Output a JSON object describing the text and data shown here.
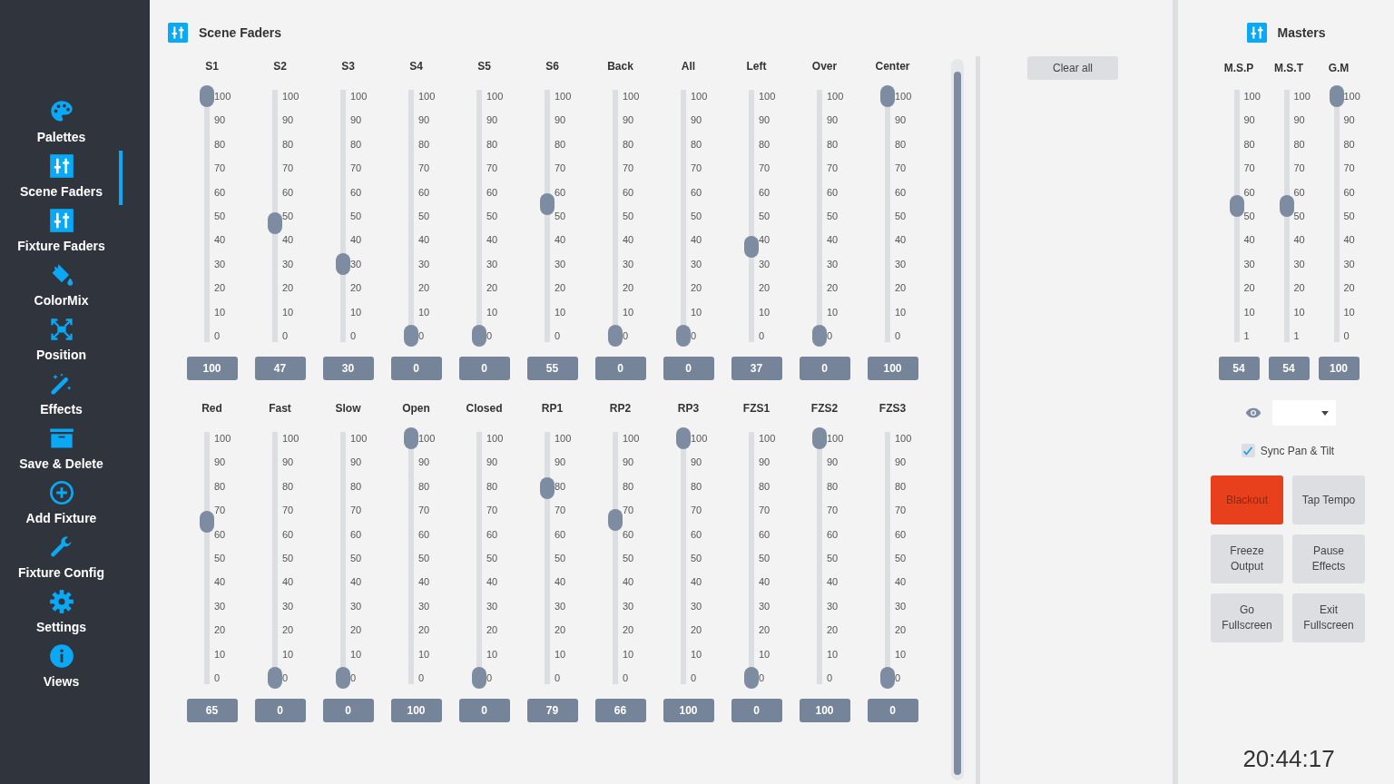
{
  "sidebar": {
    "items": [
      {
        "label": "Palettes",
        "selected": false
      },
      {
        "label": "Scene Faders",
        "selected": true
      },
      {
        "label": "Fixture Faders",
        "selected": false
      },
      {
        "label": "ColorMix",
        "selected": false
      },
      {
        "label": "Position",
        "selected": false
      },
      {
        "label": "Effects",
        "selected": false
      },
      {
        "label": "Save & Delete",
        "selected": false
      },
      {
        "label": "Add Fixture",
        "selected": false
      },
      {
        "label": "Fixture Config",
        "selected": false
      },
      {
        "label": "Settings",
        "selected": false
      },
      {
        "label": "Views",
        "selected": false
      }
    ]
  },
  "scene_faders": {
    "title": "Scene Faders",
    "rows": [
      {
        "faders": [
          {
            "label": "S1",
            "ticks": [
              "100",
              "90",
              "80",
              "70",
              "60",
              "50",
              "40",
              "30",
              "20",
              "10",
              "0"
            ],
            "level": 1,
            "value": "100"
          },
          {
            "label": "S2",
            "ticks": [
              "100",
              "90",
              "80",
              "70",
              "60",
              "50",
              "40",
              "30",
              "20",
              "10",
              "0"
            ],
            "level": 0.47,
            "value": "47"
          },
          {
            "label": "S3",
            "ticks": [
              "100",
              "90",
              "80",
              "70",
              "60",
              "50",
              "40",
              "30",
              "20",
              "10",
              "0"
            ],
            "level": 0.3,
            "value": "30"
          },
          {
            "label": "S4",
            "ticks": [
              "100",
              "90",
              "80",
              "70",
              "60",
              "50",
              "40",
              "30",
              "20",
              "10",
              "0"
            ],
            "level": 0,
            "value": "0"
          },
          {
            "label": "S5",
            "ticks": [
              "100",
              "90",
              "80",
              "70",
              "60",
              "50",
              "40",
              "30",
              "20",
              "10",
              "0"
            ],
            "level": 0,
            "value": "0"
          },
          {
            "label": "S6",
            "ticks": [
              "100",
              "90",
              "80",
              "70",
              "60",
              "50",
              "40",
              "30",
              "20",
              "10",
              "0"
            ],
            "level": 0.55,
            "value": "55"
          },
          {
            "label": "Back",
            "ticks": [
              "100",
              "90",
              "80",
              "70",
              "60",
              "50",
              "40",
              "30",
              "20",
              "10",
              "0"
            ],
            "level": 0,
            "value": "0"
          },
          {
            "label": "All",
            "ticks": [
              "100",
              "90",
              "80",
              "70",
              "60",
              "50",
              "40",
              "30",
              "20",
              "10",
              "0"
            ],
            "level": 0,
            "value": "0"
          },
          {
            "label": "Left",
            "ticks": [
              "100",
              "90",
              "80",
              "70",
              "60",
              "50",
              "40",
              "30",
              "20",
              "10",
              "0"
            ],
            "level": 0.37,
            "value": "37"
          },
          {
            "label": "Over",
            "ticks": [
              "100",
              "90",
              "80",
              "70",
              "60",
              "50",
              "40",
              "30",
              "20",
              "10",
              "0"
            ],
            "level": 0,
            "value": "0"
          },
          {
            "label": "Center",
            "ticks": [
              "100",
              "90",
              "80",
              "70",
              "60",
              "50",
              "40",
              "30",
              "20",
              "10",
              "0"
            ],
            "level": 1,
            "value": "100"
          }
        ]
      },
      {
        "faders": [
          {
            "label": "Red",
            "ticks": [
              "100",
              "90",
              "80",
              "70",
              "60",
              "50",
              "40",
              "30",
              "20",
              "10",
              "0"
            ],
            "level": 0.65,
            "value": "65"
          },
          {
            "label": "Fast",
            "ticks": [
              "100",
              "90",
              "80",
              "70",
              "60",
              "50",
              "40",
              "30",
              "20",
              "10",
              "0"
            ],
            "level": 0,
            "value": "0"
          },
          {
            "label": "Slow",
            "ticks": [
              "100",
              "90",
              "80",
              "70",
              "60",
              "50",
              "40",
              "30",
              "20",
              "10",
              "0"
            ],
            "level": 0,
            "value": "0"
          },
          {
            "label": "Open",
            "ticks": [
              "100",
              "90",
              "80",
              "70",
              "60",
              "50",
              "40",
              "30",
              "20",
              "10",
              "0"
            ],
            "level": 1,
            "value": "100"
          },
          {
            "label": "Closed",
            "ticks": [
              "100",
              "90",
              "80",
              "70",
              "60",
              "50",
              "40",
              "30",
              "20",
              "10",
              "0"
            ],
            "level": 0,
            "value": "0"
          },
          {
            "label": "RP1",
            "ticks": [
              "100",
              "90",
              "80",
              "70",
              "60",
              "50",
              "40",
              "30",
              "20",
              "10",
              "0"
            ],
            "level": 0.79,
            "value": "79"
          },
          {
            "label": "RP2",
            "ticks": [
              "100",
              "90",
              "80",
              "70",
              "60",
              "50",
              "40",
              "30",
              "20",
              "10",
              "0"
            ],
            "level": 0.66,
            "value": "66"
          },
          {
            "label": "RP3",
            "ticks": [
              "100",
              "90",
              "80",
              "70",
              "60",
              "50",
              "40",
              "30",
              "20",
              "10",
              "0"
            ],
            "level": 1,
            "value": "100"
          },
          {
            "label": "FZS1",
            "ticks": [
              "100",
              "90",
              "80",
              "70",
              "60",
              "50",
              "40",
              "30",
              "20",
              "10",
              "0"
            ],
            "level": 0,
            "value": "0"
          },
          {
            "label": "FZS2",
            "ticks": [
              "100",
              "90",
              "80",
              "70",
              "60",
              "50",
              "40",
              "30",
              "20",
              "10",
              "0"
            ],
            "level": 1,
            "value": "100"
          },
          {
            "label": "FZS3",
            "ticks": [
              "100",
              "90",
              "80",
              "70",
              "60",
              "50",
              "40",
              "30",
              "20",
              "10",
              "0"
            ],
            "level": 0,
            "value": "0"
          }
        ]
      }
    ]
  },
  "clear_all": "Clear all",
  "masters": {
    "title": "Masters",
    "faders": [
      {
        "label": "M.S.P",
        "ticks": [
          "100",
          "90",
          "80",
          "70",
          "60",
          "50",
          "40",
          "30",
          "20",
          "10",
          "1"
        ],
        "level": 0.54,
        "value": "54"
      },
      {
        "label": "M.S.T",
        "ticks": [
          "100",
          "90",
          "80",
          "70",
          "60",
          "50",
          "40",
          "30",
          "20",
          "10",
          "1"
        ],
        "level": 0.54,
        "value": "54"
      },
      {
        "label": "G.M",
        "ticks": [
          "100",
          "90",
          "80",
          "70",
          "60",
          "50",
          "40",
          "30",
          "20",
          "10",
          "0"
        ],
        "level": 1,
        "value": "100"
      }
    ],
    "sync_pan_tilt": {
      "label": "Sync Pan & Tilt",
      "checked": true
    },
    "buttons": [
      {
        "label": "Blackout",
        "kind": "alert"
      },
      {
        "label": "Tap Tempo",
        "kind": "normal"
      },
      {
        "label": "Freeze Output",
        "kind": "normal"
      },
      {
        "label": "Pause Effects",
        "kind": "normal"
      },
      {
        "label": "Go Fullscreen",
        "kind": "normal"
      },
      {
        "label": "Exit Fullscreen",
        "kind": "normal"
      }
    ]
  },
  "clock": "20:44:17"
}
